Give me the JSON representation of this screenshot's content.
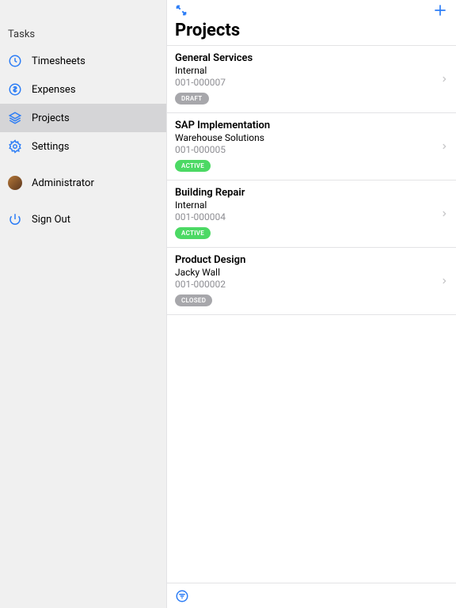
{
  "sidebar": {
    "section_label": "Tasks",
    "items": [
      {
        "label": "Timesheets"
      },
      {
        "label": "Expenses"
      },
      {
        "label": "Projects"
      },
      {
        "label": "Settings"
      }
    ],
    "user_label": "Administrator",
    "signout_label": "Sign Out"
  },
  "header": {
    "title": "Projects"
  },
  "projects": [
    {
      "name": "General Services",
      "assignee": "Internal",
      "code": "001-000007",
      "status": "DRAFT",
      "status_kind": "draft"
    },
    {
      "name": "SAP Implementation",
      "assignee": "Warehouse Solutions",
      "code": "001-000005",
      "status": "ACTIVE",
      "status_kind": "active"
    },
    {
      "name": "Building Repair",
      "assignee": "Internal",
      "code": "001-000004",
      "status": "ACTIVE",
      "status_kind": "active"
    },
    {
      "name": "Product Design",
      "assignee": "Jacky Wall",
      "code": "001-000002",
      "status": "CLOSED",
      "status_kind": "closed"
    }
  ],
  "colors": {
    "accent": "#2c7df6"
  }
}
